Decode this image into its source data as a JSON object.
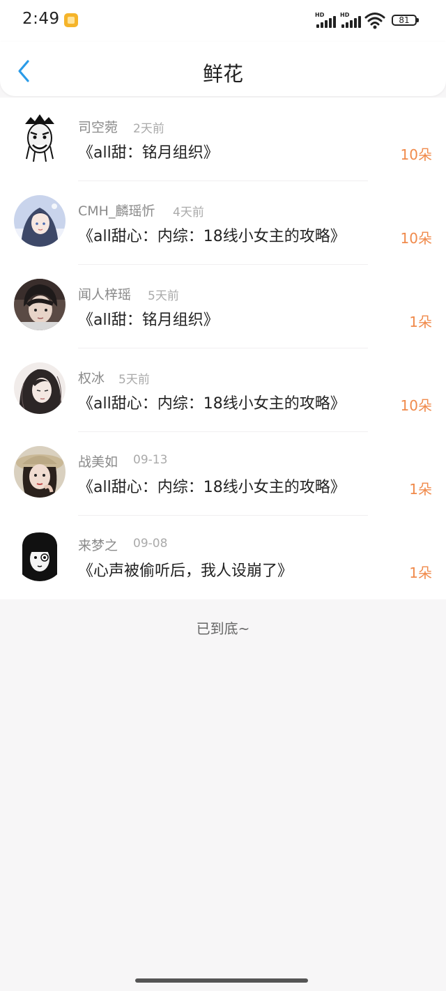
{
  "status_bar": {
    "time": "2:49",
    "signal1_label": "HD",
    "signal2_label": "HD",
    "battery": "81",
    "icons": [
      "notification-app-icon",
      "signal-icon",
      "signal-icon",
      "wifi-icon",
      "battery-icon"
    ]
  },
  "header": {
    "title": "鲜花",
    "back_icon": "chevron-left-icon",
    "accent_color": "#2a9be8"
  },
  "list": [
    {
      "user": "司空菀",
      "time": "2天前",
      "book": "《all甜：铭月组织》",
      "count": "10朵"
    },
    {
      "user": "CMH_麟瑶忻",
      "time": "4天前",
      "book": "《all甜心：内综：18线小女主的攻略》",
      "count": "10朵"
    },
    {
      "user": "闻人梓瑶",
      "time": "5天前",
      "book": "《all甜：铭月组织》",
      "count": "1朵"
    },
    {
      "user": "权冰",
      "time": "5天前",
      "book": "《all甜心：内综：18线小女主的攻略》",
      "count": "10朵"
    },
    {
      "user": "战美如",
      "time": "09-13",
      "book": "《all甜心：内综：18线小女主的攻略》",
      "count": "1朵"
    },
    {
      "user": "来梦之",
      "time": "09-08",
      "book": "《心声被偷听后，我人设崩了》",
      "count": "1朵"
    }
  ],
  "footer": {
    "end_text": "已到底~"
  },
  "colors": {
    "count_color": "#f08a4b",
    "page_background": "#f7f6f7"
  }
}
